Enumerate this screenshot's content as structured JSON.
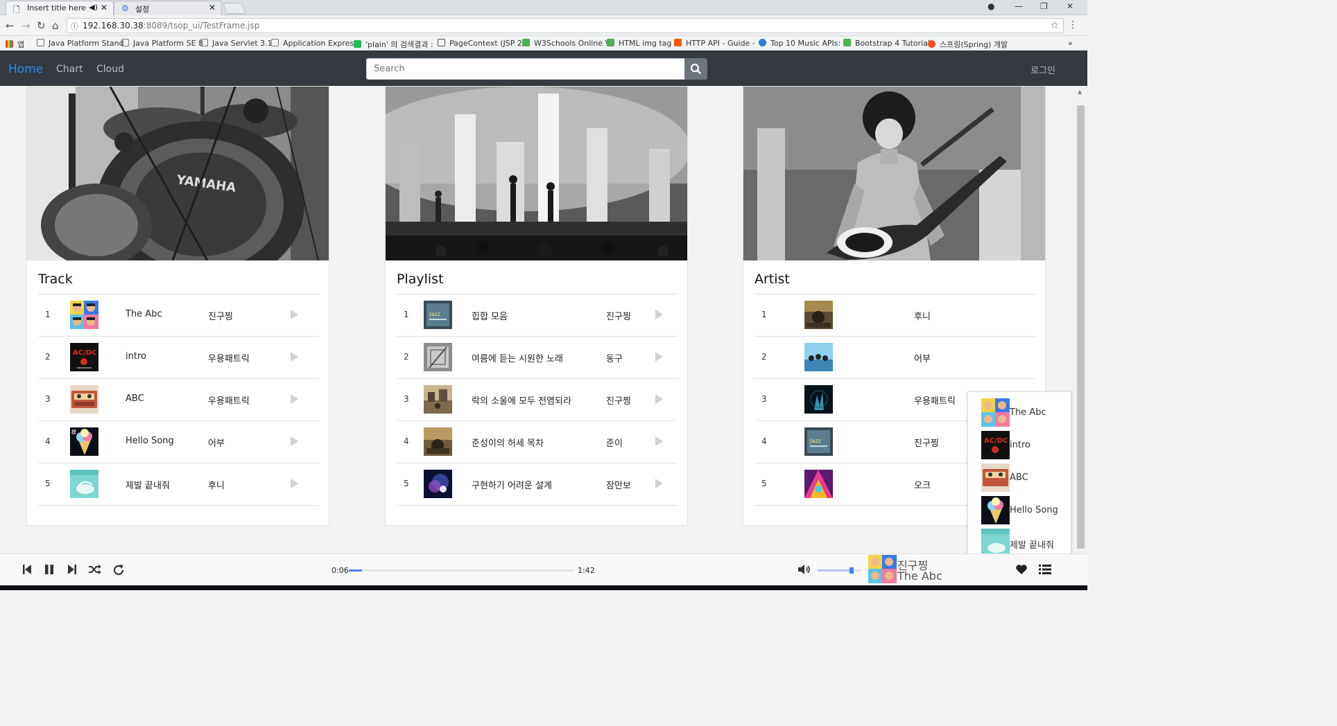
{
  "browser": {
    "tabs": [
      {
        "title": "Insert title here",
        "icon": "page-icon"
      },
      {
        "title": "설정",
        "icon": "gear-icon"
      }
    ],
    "url_host": "192.168.30.38",
    "url_path": ":8089/tsop_ui/TestFrame.jsp",
    "bookmarks": [
      "앱",
      "Java Platform Stand",
      "Java Platform SE 8",
      "Java Servlet 3.1",
      "Application Express",
      "'plain' 의 검색결과 :",
      "PageContext (JSP 2.",
      "W3Schools Online V",
      "HTML img tag",
      "HTTP API - Guide -",
      "Top 10 Music APIs:",
      "Bootstrap 4 Tutorial",
      "스프링(Spring) 개발"
    ],
    "more_bookmarks": "»"
  },
  "nav": {
    "home": "Home",
    "chart": "Chart",
    "cloud": "Cloud",
    "search_placeholder": "Search",
    "login": "로그인",
    "accent": "#2b8cf1"
  },
  "cards": {
    "track": {
      "title": "Track",
      "rows": [
        {
          "num": "1",
          "name": "The Abc",
          "artist": "진구찡"
        },
        {
          "num": "2",
          "name": "intro",
          "artist": "우용패트릭"
        },
        {
          "num": "3",
          "name": "ABC",
          "artist": "우용패트릭"
        },
        {
          "num": "4",
          "name": "Hello Song",
          "artist": "어부"
        },
        {
          "num": "5",
          "name": "제발 끝내줘",
          "artist": "후니"
        }
      ]
    },
    "playlist": {
      "title": "Playlist",
      "rows": [
        {
          "num": "1",
          "name": "힙합 모음",
          "owner": "진구찡"
        },
        {
          "num": "2",
          "name": "여름에 듣는 시원한 노래",
          "owner": "동구"
        },
        {
          "num": "3",
          "name": "락의 소울에 모두 전염되라",
          "owner": "진구찡"
        },
        {
          "num": "4",
          "name": "준성이의 허세 목차",
          "owner": "준이"
        },
        {
          "num": "5",
          "name": "구현하기 어려운 설계",
          "owner": "잠만보"
        }
      ]
    },
    "artist": {
      "title": "Artist",
      "rows": [
        {
          "num": "1",
          "name": "후니"
        },
        {
          "num": "2",
          "name": "어부"
        },
        {
          "num": "3",
          "name": "우용패트릭"
        },
        {
          "num": "4",
          "name": "진구찡"
        },
        {
          "num": "5",
          "name": "오크"
        }
      ]
    }
  },
  "queue_popup": {
    "items": [
      "The Abc",
      "intro",
      "ABC",
      "Hello Song",
      "제발 끝내줘"
    ]
  },
  "player": {
    "current_time": "0:06",
    "duration": "1:42",
    "progress": 0.06,
    "volume": 0.78,
    "now_artist": "진구찡",
    "now_title": "The Abc",
    "accent": "#4a7df0"
  }
}
